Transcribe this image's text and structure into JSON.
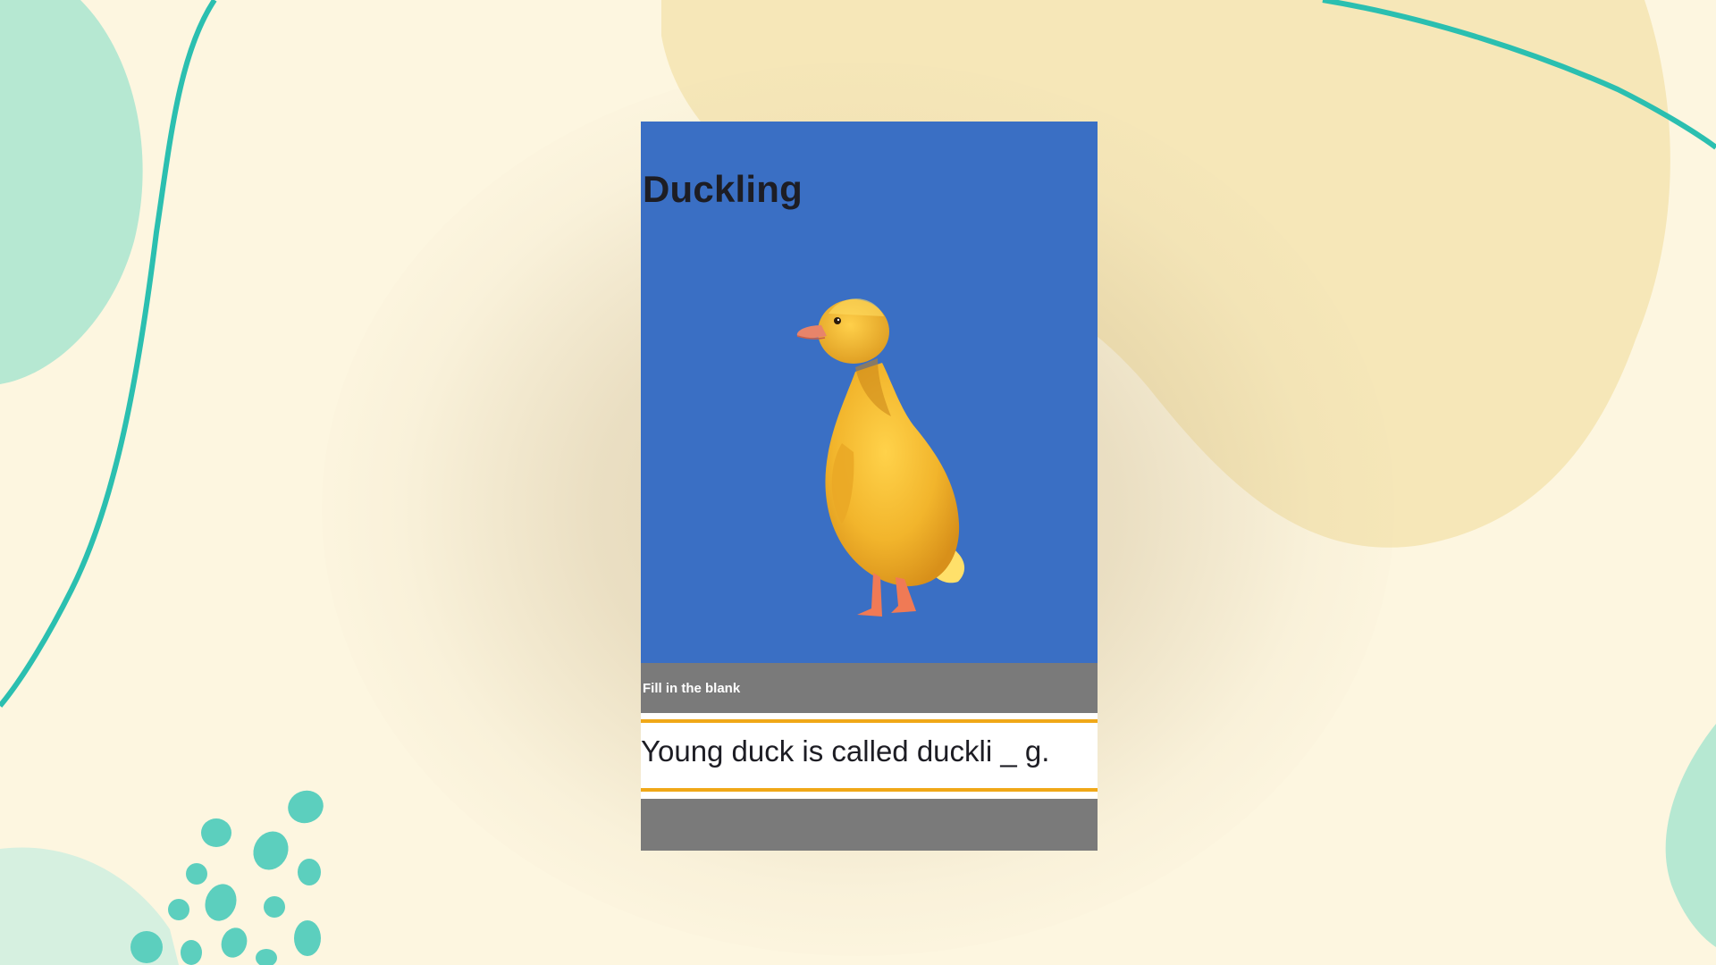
{
  "colors": {
    "background": "#fdf6e0",
    "teal": "#2bbfb0",
    "mint": "#b6e8d2",
    "blob_yellow": "#f5e4b0",
    "card_blue": "#3a6fc4",
    "card_gray": "#7a7a7a",
    "accent_orange": "#f0a818",
    "text_dark": "#1d1d24"
  },
  "card": {
    "title": "Duckling",
    "image": "duckling-photo",
    "prompt_label": "Fill in the blank",
    "sentence": "Young duck is called duckli _ g."
  }
}
